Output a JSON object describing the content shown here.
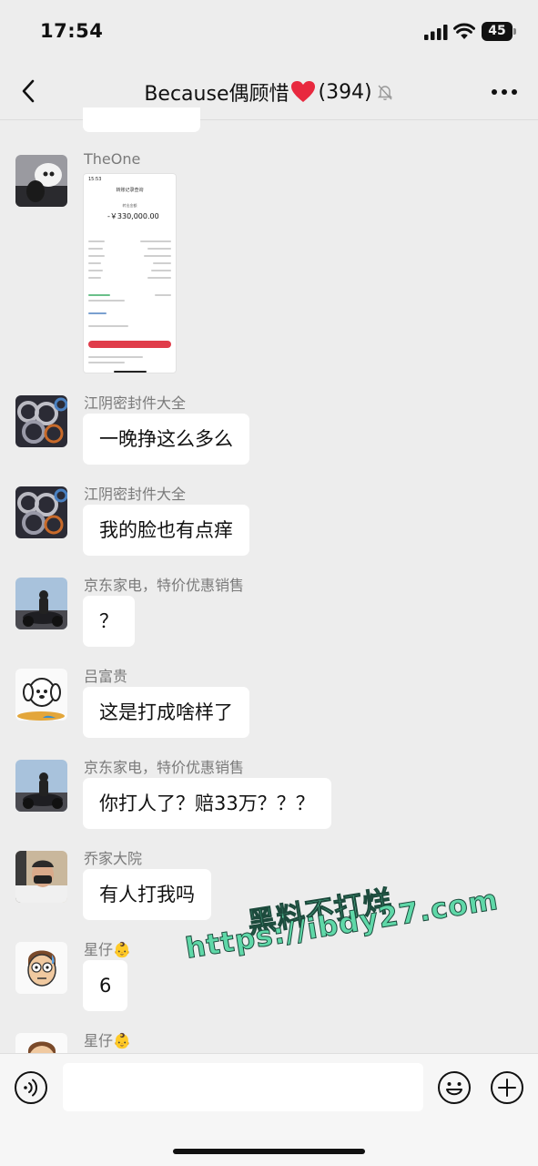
{
  "status_bar": {
    "time": "17:54",
    "battery": "45"
  },
  "chat": {
    "title": "Because偶顾惜",
    "count": "(394)"
  },
  "messages": [
    {
      "sender": "TheOne",
      "type": "image",
      "screenshot": {
        "time": "15:53",
        "title": "转账记录查询",
        "label": "转出金额",
        "amount": "-￥330,000.00"
      }
    },
    {
      "sender": "江阴密封件大全",
      "text": "一晚挣这么多么"
    },
    {
      "sender": "江阴密封件大全",
      "text": "我的脸也有点痒"
    },
    {
      "sender": "京东家电，特价优惠销售",
      "text": "？"
    },
    {
      "sender": "吕富贵",
      "text": "这是打成啥样了"
    },
    {
      "sender": "京东家电，特价优惠销售",
      "text": "你打人了？赔33万？？？"
    },
    {
      "sender": "乔家大院",
      "text": "有人打我吗"
    },
    {
      "sender": "星仔👶",
      "text": "6"
    },
    {
      "sender": "星仔👶"
    }
  ],
  "watermark": {
    "line1": "黑料不打烊",
    "line2": "https://ibdy27.com"
  },
  "icons": {
    "back": "chevron-left-icon",
    "mute": "bell-slash-icon",
    "more": "ellipsis-icon",
    "voice": "voice-icon",
    "emoji": "smiley-icon",
    "plus": "plus-circle-icon"
  },
  "colors": {
    "background": "#ededed",
    "bubble": "#ffffff",
    "watermark": "#5fd8a8",
    "heart": "#e8293f"
  }
}
